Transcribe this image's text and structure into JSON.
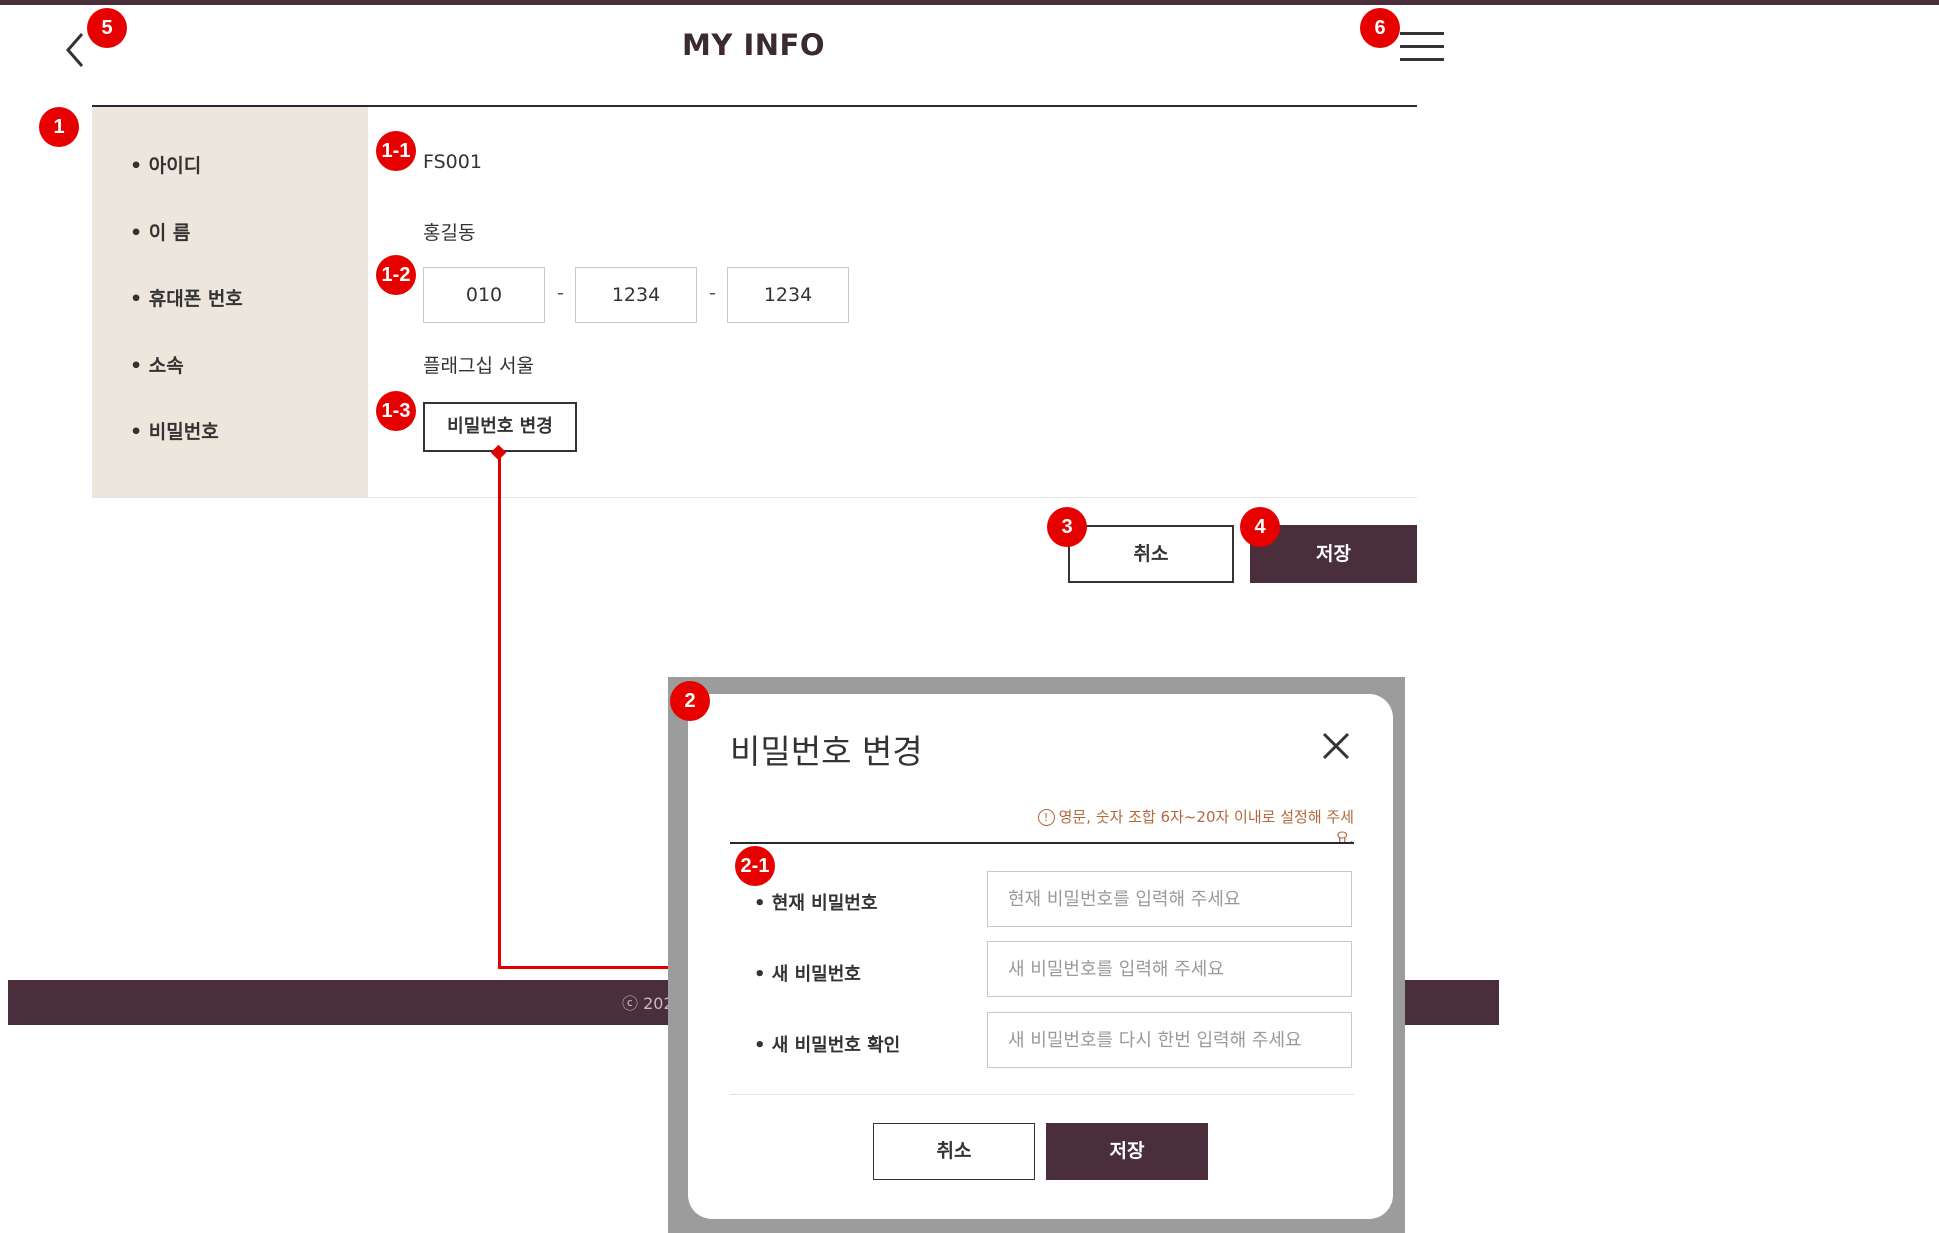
{
  "header": {
    "title": "MY INFO"
  },
  "form": {
    "rows": [
      {
        "label": "아이디",
        "value": "FS001"
      },
      {
        "label": "이 름",
        "value": "홍길동"
      },
      {
        "label": "휴대폰 번호",
        "value": ""
      },
      {
        "label": "소속",
        "value": "플래그십 서울"
      },
      {
        "label": "비밀번호",
        "value": ""
      }
    ],
    "phone": [
      "010",
      "1234",
      "1234"
    ],
    "phone_separator": "-",
    "change_password_label": "비밀번호 변경"
  },
  "actions": {
    "cancel_label": "취소",
    "save_label": "저장"
  },
  "footer": {
    "copyright_fragment": "ⓒ 202"
  },
  "modal": {
    "title": "비밀번호 변경",
    "hint_icon": "!",
    "hint": "영문, 숫자 조합 6자~20자 이내로 설정해 주세요.",
    "fields": [
      {
        "label": "현재 비밀번호",
        "placeholder": "현재 비밀번호를 입력해 주세요"
      },
      {
        "label": "새 비밀번호",
        "placeholder": "새 비밀번호를 입력해 주세요"
      },
      {
        "label": "새 비밀번호 확인",
        "placeholder": "새 비밀번호를 다시 한번 입력해 주세요"
      }
    ],
    "cancel_label": "취소",
    "save_label": "저장"
  },
  "annotations": [
    "1",
    "1-1",
    "1-2",
    "1-3",
    "2",
    "2-1",
    "3",
    "4",
    "5",
    "6"
  ],
  "colors": {
    "brand": "#4a2e3c",
    "label_bg": "#ece6dc",
    "annotation": "#e60000",
    "hint": "#b5673d"
  }
}
